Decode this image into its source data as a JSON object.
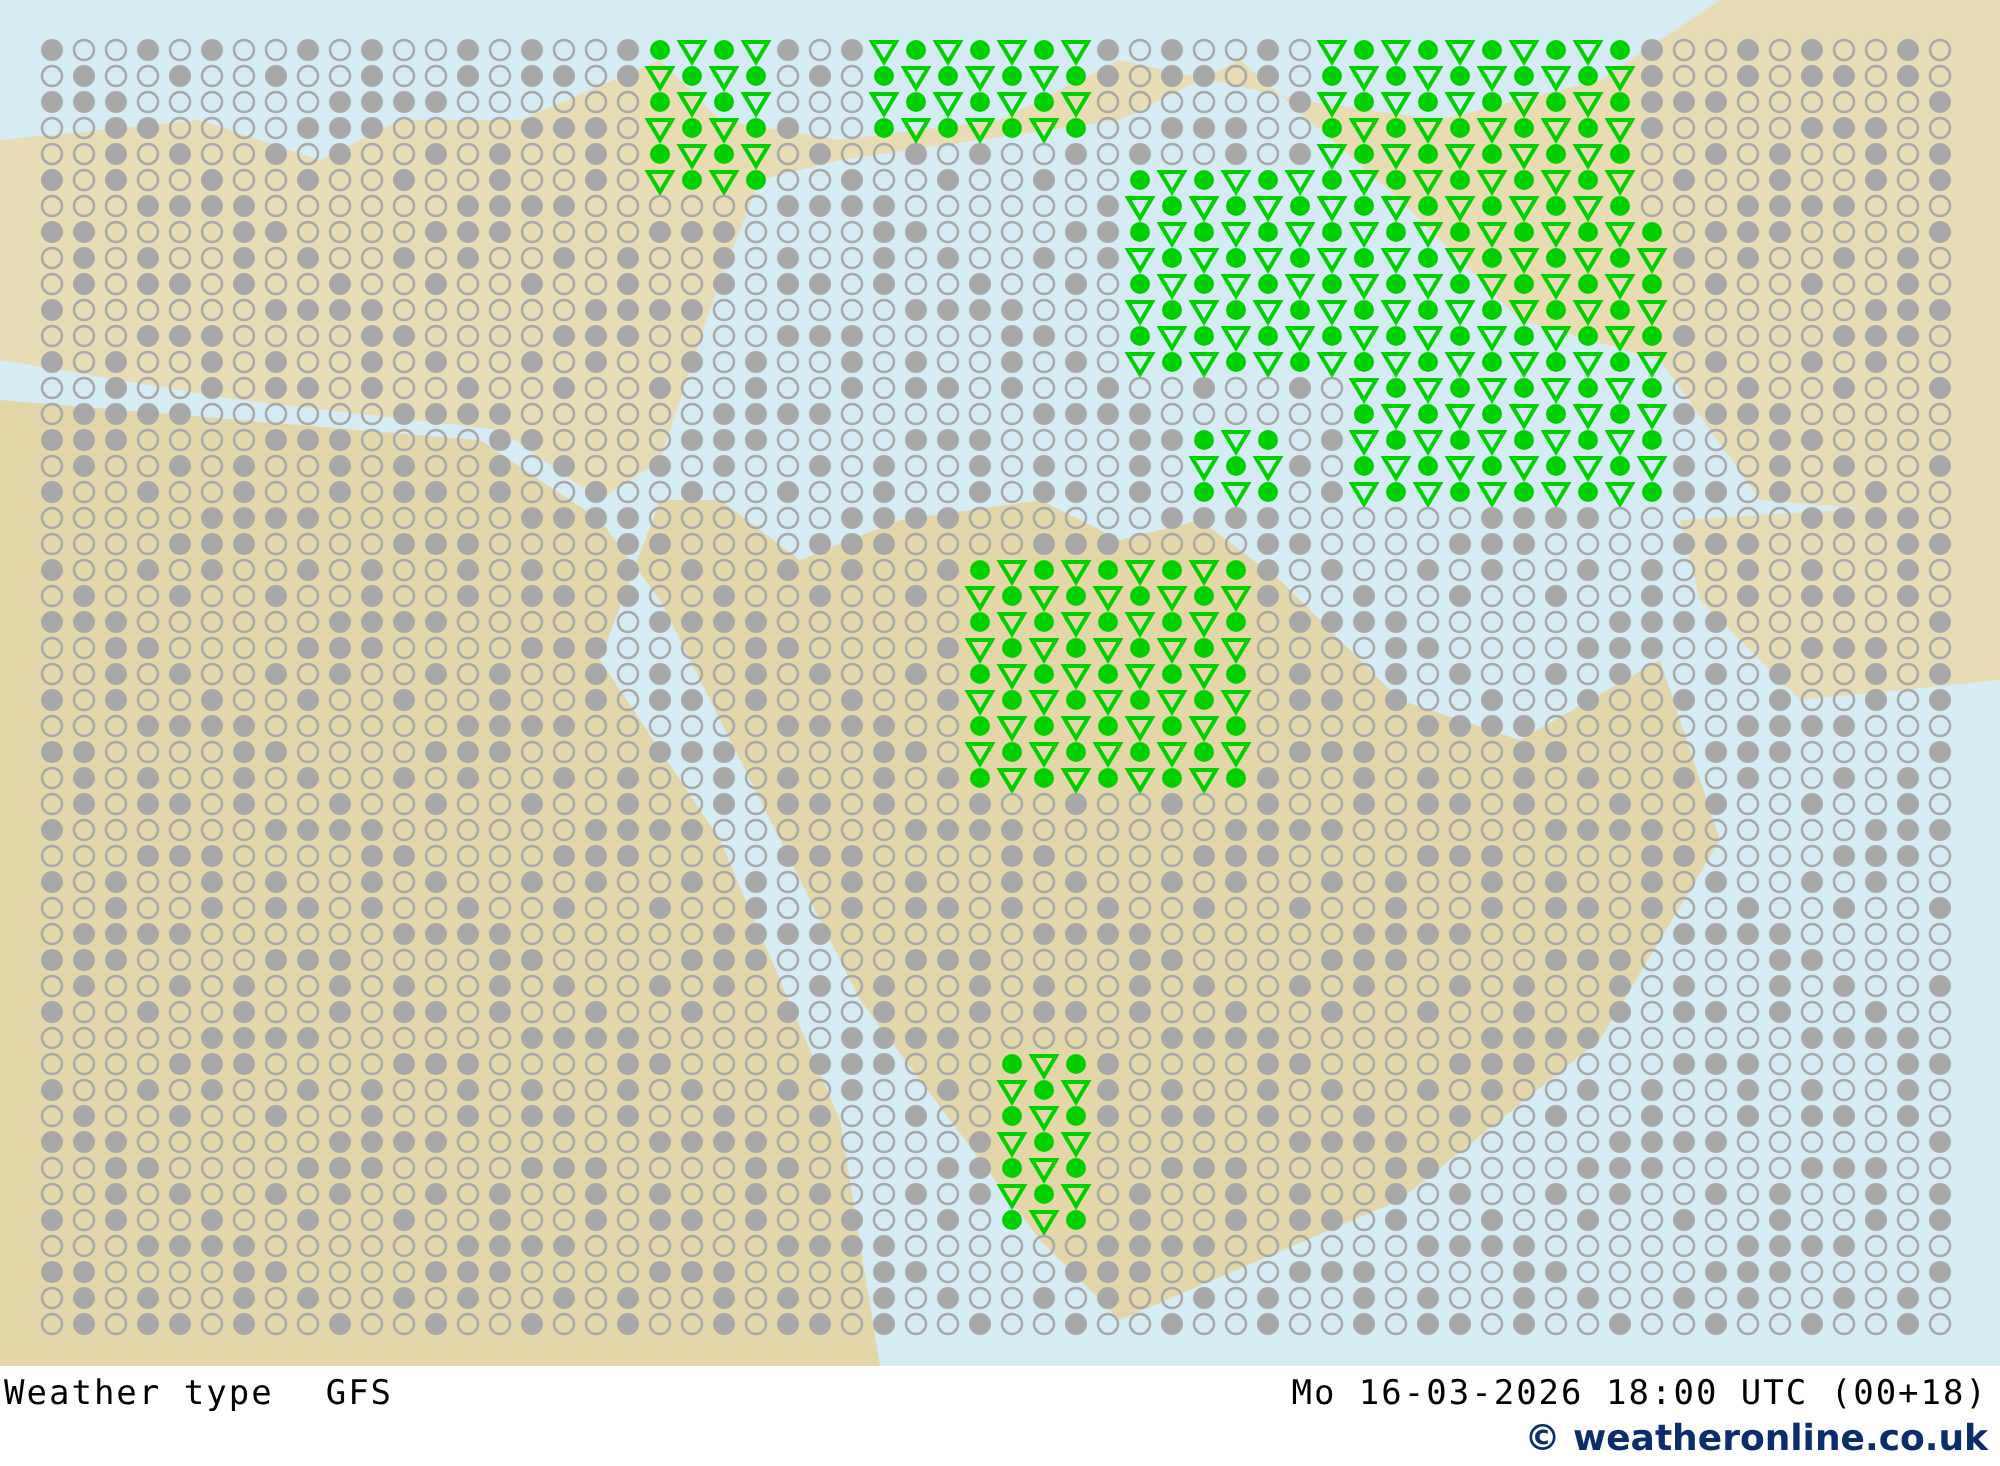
{
  "map": {
    "title": "Weather type",
    "model": "GFS"
  },
  "valid_time": "Mo 16-03-2026 18:00 UTC (00+18)",
  "credit": "© weatheronline.co.uk"
}
